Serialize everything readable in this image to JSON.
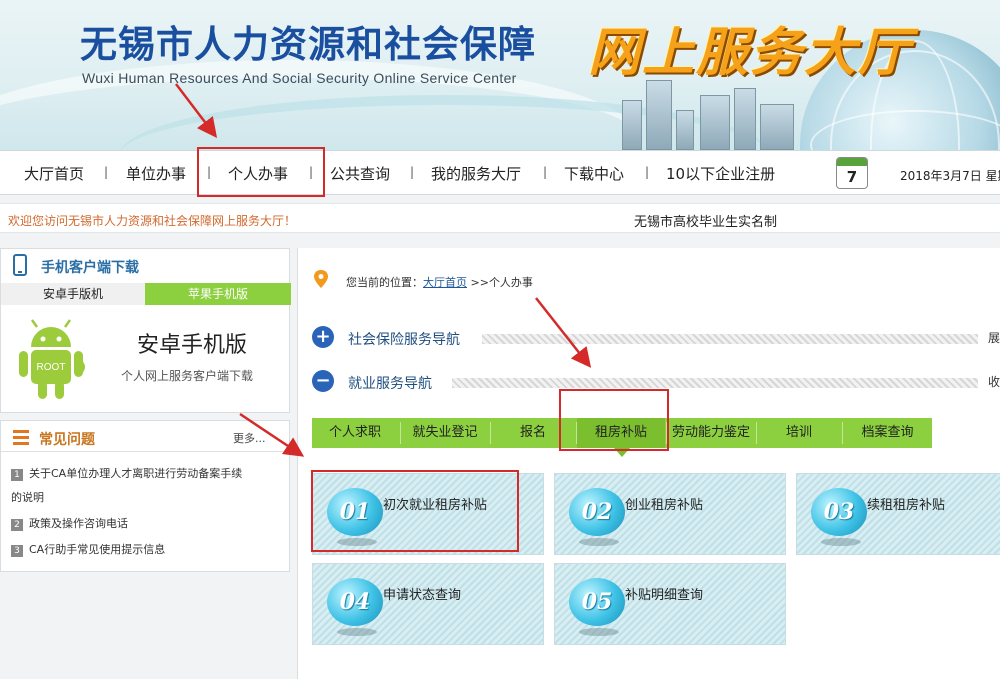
{
  "header": {
    "title_cn": "无锡市人力资源和社会保障",
    "title_en": "Wuxi Human Resources And Social Security Online Service Center",
    "hall": "网上服务大厅"
  },
  "nav": {
    "items": [
      "大厅首页",
      "单位办事",
      "个人办事",
      "公共查询",
      "我的服务大厅",
      "下载中心",
      "10以下企业注册"
    ],
    "separator": "|",
    "calendar_day": "7",
    "date": "2018年3月7日 星期"
  },
  "strip": {
    "welcome": "欢迎您访问无锡市人力资源和社会保障网上服务大厅！",
    "news": "无锡市高校毕业生实名制"
  },
  "app_panel": {
    "title": "手机客户端下载",
    "tabs": [
      "安卓手版机",
      "苹果手机版"
    ],
    "android_label": "ROOT",
    "name": "安卓手机版",
    "subtitle": "个人网上服务客户端下载"
  },
  "faq": {
    "title": "常见问题",
    "more": "更多...",
    "items": [
      {
        "num": "1",
        "line1": "关于CA单位办理人才离职进行劳动备案手续",
        "line2": "的说明"
      },
      {
        "num": "2",
        "line1": "政策及操作咨询电话"
      },
      {
        "num": "3",
        "line1": "CA行助手常见使用提示信息"
      }
    ]
  },
  "breadcrumb": {
    "prefix": "您当前的位置：",
    "home": "大厅首页",
    "sep": ">>",
    "current": "个人办事"
  },
  "sections": [
    {
      "icon": "+",
      "label": "社会保险服务导航",
      "tail": "展"
    },
    {
      "icon": "−",
      "label": "就业服务导航",
      "tail": "收"
    }
  ],
  "tabs": [
    "个人求职",
    "就失业登记",
    "报名",
    "租房补贴",
    "劳动能力鉴定",
    "培训",
    "档案查询"
  ],
  "active_tab": "租房补贴",
  "cards": [
    {
      "num": "01",
      "label": "初次就业租房补贴"
    },
    {
      "num": "02",
      "label": "创业租房补贴"
    },
    {
      "num": "03",
      "label": "续租租房补贴"
    },
    {
      "num": "04",
      "label": "申请状态查询"
    },
    {
      "num": "05",
      "label": "补贴明细查询"
    }
  ],
  "colors": {
    "accent_green": "#8ccf3f",
    "title_blue": "#1a4fa0",
    "hall_orange": "#f5a21a",
    "highlight_red": "#d42a2a"
  }
}
